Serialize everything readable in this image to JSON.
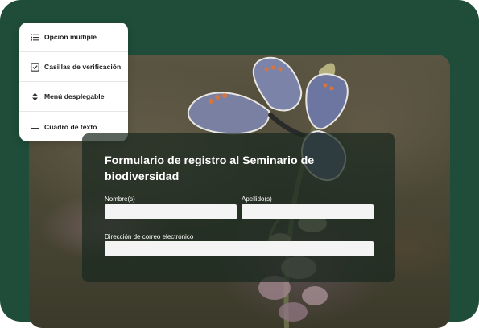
{
  "field_types_menu": {
    "items": [
      {
        "label": "Opción múltiple",
        "icon": "list-icon"
      },
      {
        "label": "Casillas de verificación",
        "icon": "checkbox-icon"
      },
      {
        "label": "Menú desplegable",
        "icon": "dropdown-arrows-icon"
      },
      {
        "label": "Cuadro de texto",
        "icon": "text-box-icon"
      }
    ]
  },
  "form": {
    "title": "Formulario de registro al Seminario de biodiversidad",
    "first_name_label": "Nombre(s)",
    "last_name_label": "Apellido(s)",
    "email_label": "Dirección de correo electrónico",
    "first_name_value": "",
    "last_name_value": "",
    "email_value": ""
  },
  "colors": {
    "background": "#1f4d3a",
    "menu": "#ffffff",
    "form_overlay": "rgba(25,40,30,0.72)"
  }
}
